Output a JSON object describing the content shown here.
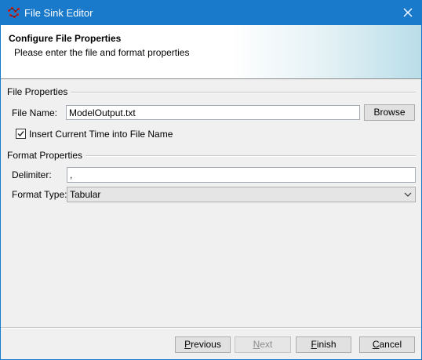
{
  "window": {
    "title": "File Sink Editor"
  },
  "banner": {
    "heading": "Configure File Properties",
    "subheading": "Please enter the file and format properties"
  },
  "file_properties": {
    "section_label": "File Properties",
    "file_name_label": "File Name:",
    "file_name_value": "ModelOutput.txt",
    "browse_label": "Browse",
    "insert_time_label": "Insert Current Time into File Name",
    "insert_time_checked": true
  },
  "format_properties": {
    "section_label": "Format Properties",
    "delimiter_label": "Delimiter:",
    "delimiter_value": ",",
    "format_type_label": "Format Type:",
    "format_type_value": "Tabular"
  },
  "buttons": {
    "previous": {
      "pre": "",
      "mnemonic": "P",
      "post": "revious",
      "enabled": true
    },
    "next": {
      "pre": "",
      "mnemonic": "N",
      "post": "ext",
      "enabled": false
    },
    "finish": {
      "pre": "",
      "mnemonic": "F",
      "post": "inish",
      "enabled": true
    },
    "cancel": {
      "pre": "",
      "mnemonic": "C",
      "post": "ancel",
      "enabled": true
    }
  },
  "icons": {
    "app": "java-app-icon",
    "close": "close-icon",
    "check": "check-icon",
    "dropdown": "chevron-down-icon"
  },
  "colors": {
    "titlebar": "#1979ca",
    "dialog_background": "#f0f0f0"
  }
}
